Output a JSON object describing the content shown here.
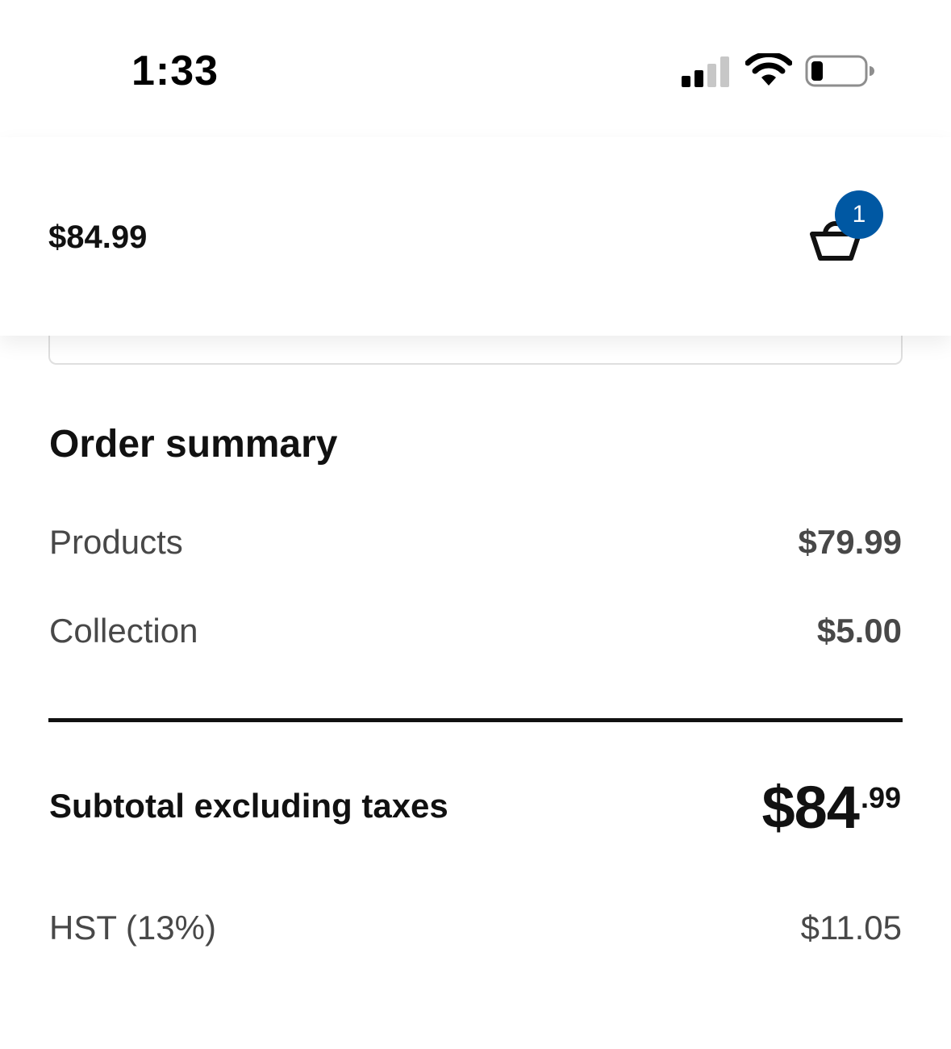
{
  "status_bar": {
    "time": "1:33",
    "icons": [
      "cellular-signal-icon",
      "wifi-icon",
      "battery-icon"
    ]
  },
  "header": {
    "total": "$84.99",
    "cart_icon": "shopping-basket-icon",
    "cart_count": "1",
    "badge_color": "#0058a3"
  },
  "order_summary": {
    "title": "Order summary",
    "lines": [
      {
        "label": "Products",
        "value": "$79.99"
      },
      {
        "label": "Collection",
        "value": "$5.00"
      }
    ],
    "subtotal": {
      "label": "Subtotal excluding taxes",
      "price_main": "$84",
      "price_cents": ".99"
    },
    "tax": {
      "label": "HST (13%)",
      "value": "$11.05"
    }
  }
}
